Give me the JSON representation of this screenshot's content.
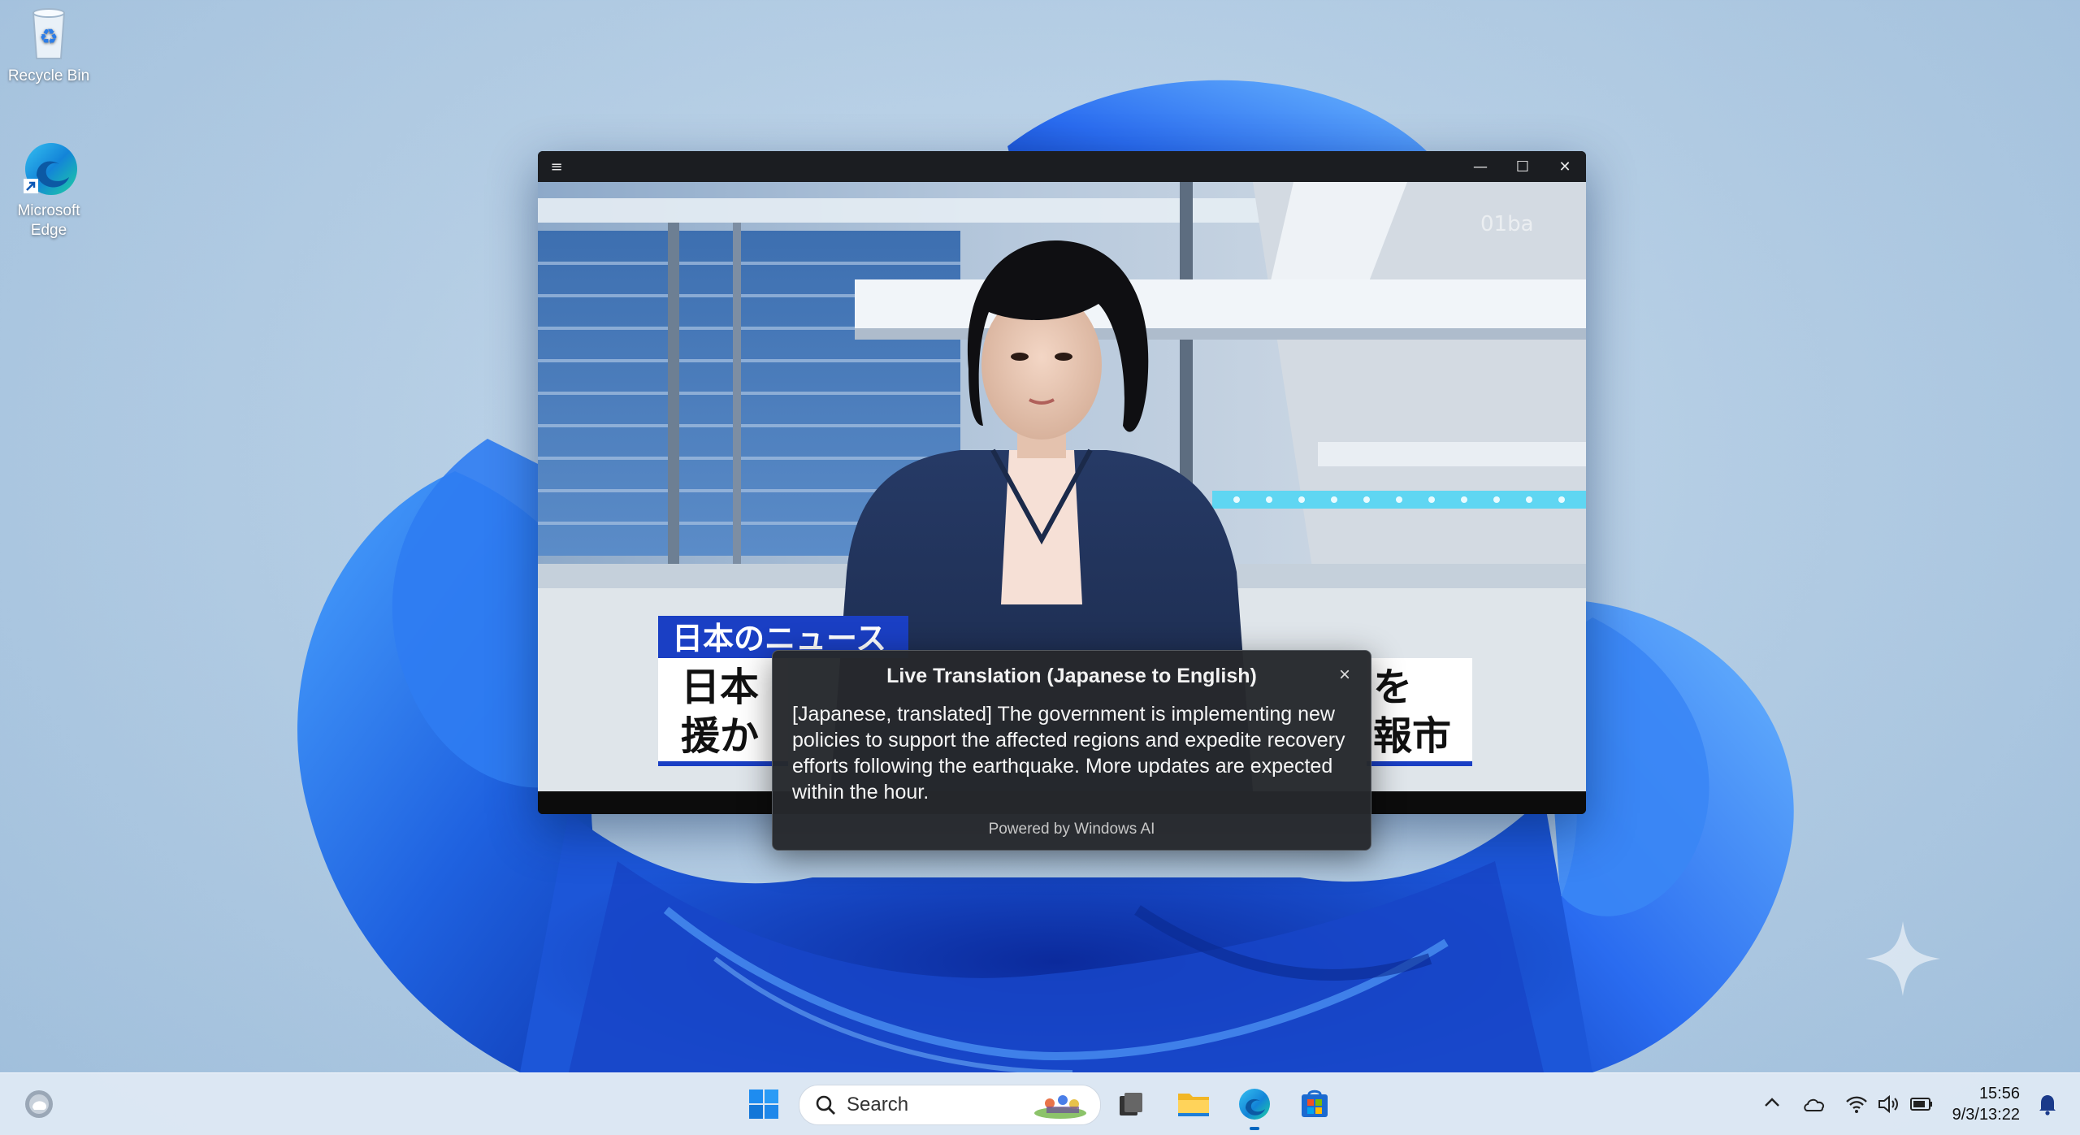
{
  "desktop": {
    "icons": [
      {
        "label": "Recycle Bin"
      },
      {
        "label": "Microsoft Edge"
      }
    ]
  },
  "player": {
    "video": {
      "banner_title": "日本のニュース",
      "caption_line1_left": "日本",
      "caption_line1_right": "を",
      "caption_line2_left": "援か",
      "caption_line2_right": "報市",
      "watermark": "01ba"
    }
  },
  "translation": {
    "title": "Live Translation (Japanese to English)",
    "text": "[Japanese, translated] The government is implementing new policies to support the affected regions and expedite recovery efforts following the earthquake. More updates are expected within the hour.",
    "footer": "Powered by Windows AI"
  },
  "taskbar": {
    "search_placeholder": "Search",
    "pinned": [
      "start-icon",
      "search",
      "task-view-icon",
      "file-explorer-icon",
      "edge-icon",
      "store-icon"
    ],
    "time": "15:56",
    "date": "9/3/13:22"
  },
  "colors": {
    "accent": "#0067c0",
    "bloom": "#1f62e0",
    "news_blue": "#1a3fc4"
  }
}
